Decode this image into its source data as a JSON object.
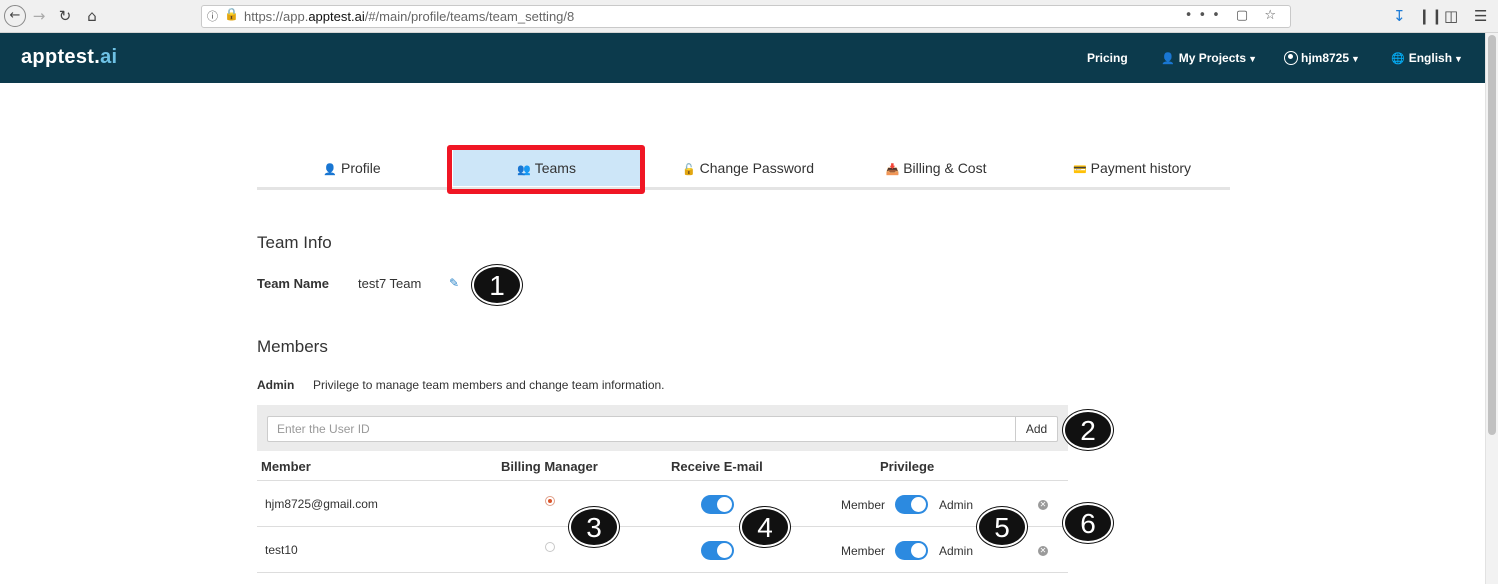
{
  "browser": {
    "url_prefix": "https://app.",
    "url_domain": "apptest.ai",
    "url_path": "/#/main/profile/teams/team_setting/8",
    "url_actions": "••• ▢ ☆"
  },
  "header": {
    "logo_main": "apptest.",
    "logo_accent": "ai",
    "nav": {
      "pricing": "Pricing",
      "projects": "My Projects",
      "user": "hjm8725",
      "language": "English"
    }
  },
  "tabs": [
    {
      "label": "Profile",
      "icon": "user-icon"
    },
    {
      "label": "Teams",
      "icon": "users-icon"
    },
    {
      "label": "Change Password",
      "icon": "unlock-icon"
    },
    {
      "label": "Billing & Cost",
      "icon": "inbox-icon"
    },
    {
      "label": "Payment history",
      "icon": "credit-card-icon"
    }
  ],
  "team_info": {
    "title": "Team Info",
    "name_label": "Team Name",
    "name_value": "test7 Team"
  },
  "members": {
    "title": "Members",
    "admin_label": "Admin",
    "admin_desc": "Privilege to manage team members and change team information.",
    "input_placeholder": "Enter the User ID",
    "add_label": "Add",
    "columns": {
      "member": "Member",
      "billing": "Billing Manager",
      "email": "Receive E-mail",
      "privilege": "Privilege"
    },
    "rows": [
      {
        "member": "hjm8725@gmail.com",
        "billing_manager": true,
        "receive_email": true,
        "priv_member": "Member",
        "priv_admin": "Admin"
      },
      {
        "member": "test10",
        "billing_manager": false,
        "receive_email": true,
        "priv_member": "Member",
        "priv_admin": "Admin"
      }
    ]
  },
  "callouts": [
    "1",
    "2",
    "3",
    "4",
    "5",
    "6"
  ],
  "colors": {
    "header_bg": "#0c3a4c",
    "accent_blue": "#2c8ae0",
    "highlight_red": "#f01624",
    "active_tab_bg": "#cde6f8"
  }
}
